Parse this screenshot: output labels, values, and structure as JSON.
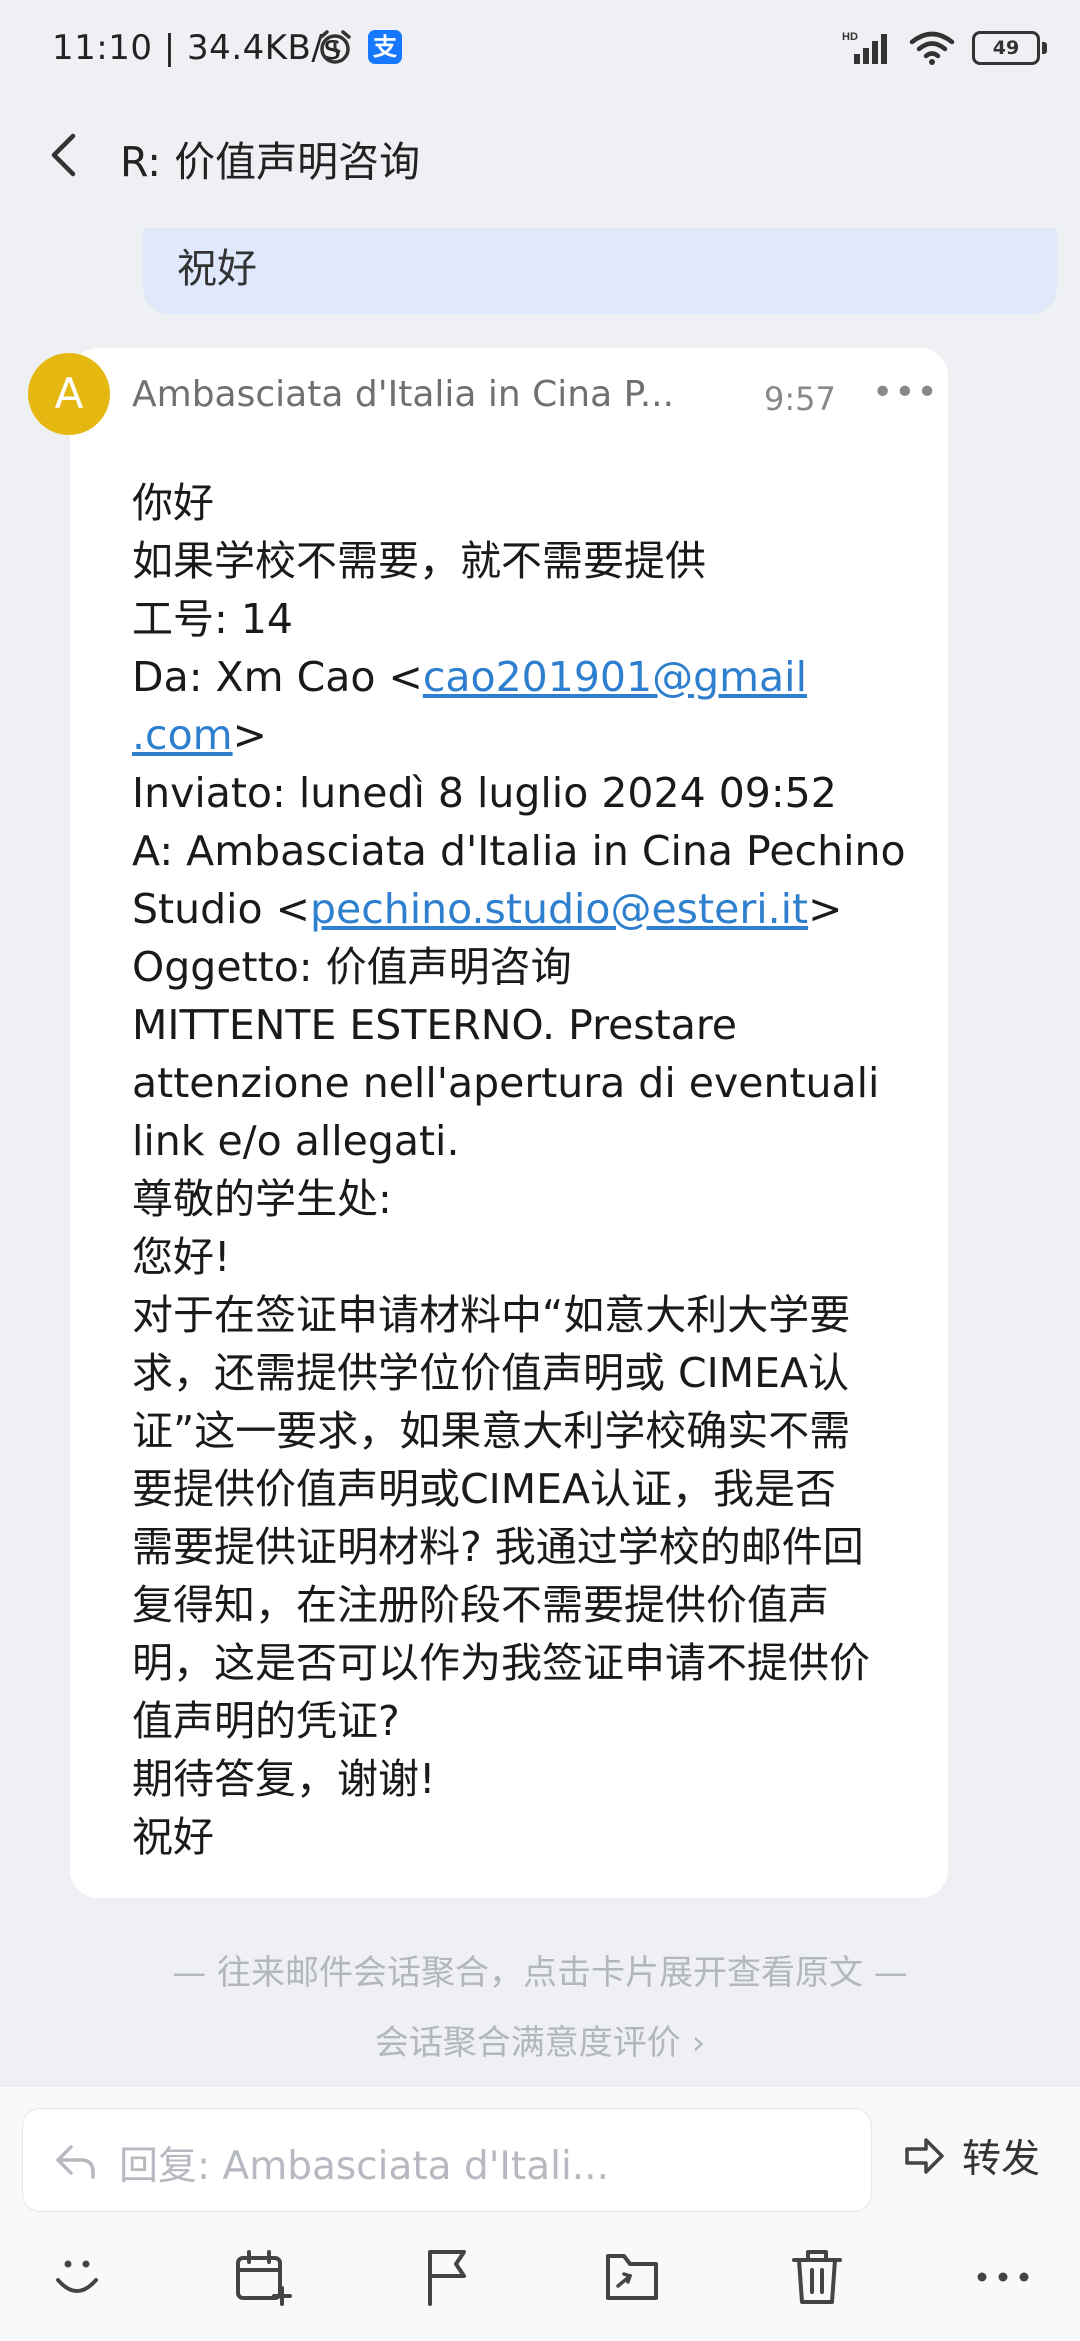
{
  "status": {
    "time": "11:10 | 34.4KB/s",
    "network": "HD",
    "battery": "49",
    "icons": [
      "alarm-icon",
      "alipay-icon",
      "signal-icon",
      "wifi-icon",
      "battery-icon"
    ]
  },
  "header": {
    "title": "R: 价值声明咨询"
  },
  "previous_message": {
    "text": "祝好"
  },
  "mail": {
    "avatar_letter": "A",
    "sender": "Ambasciata d'Italia in Cina P...",
    "time": "9:57",
    "lines": {
      "l1": "你好",
      "l2": "如果学校不需要，就不需要提供",
      "l3": "工号: 14",
      "da_prefix": "Da: Xm Cao <",
      "da_link_1": "cao201901@gmail",
      "da_link_2": ".com",
      "da_suffix": ">",
      "inviato": "Inviato: lunedì 8 luglio 2024 09:52",
      "a_line": "A: Ambasciata d'Italia in Cina Pechino",
      "studio_prefix": "Studio <",
      "studio_link": "pechino.studio@esteri.it",
      "studio_suffix": ">",
      "oggetto": "Oggetto: 价值声明咨询",
      "mittente_1": "MITTENTE ESTERNO. Prestare",
      "mittente_2": "attenzione nell'apertura di eventuali",
      "mittente_3": "link e/o allegati.",
      "greet1": "尊敬的学生处:",
      "greet2": "您好!",
      "p1": "对于在签证申请材料中“如意大利大学要",
      "p2": "求，还需提供学位价值声明或 CIMEA认",
      "p3": "证”这一要求，如果意大利学校确实不需",
      "p4": "要提供价值声明或CIMEA认证，我是否",
      "p5": "需要提供证明材料? 我通过学校的邮件回",
      "p6": "复得知，在注册阶段不需要提供价值声",
      "p7": "明，这是否可以作为我签证申请不提供价",
      "p8": "值声明的凭证?",
      "p9": "期待答复，谢谢!",
      "p10": "祝好"
    }
  },
  "footer": {
    "hint": "— 往来邮件会话聚合，点击卡片展开查看原文 —",
    "rating": "会话聚合满意度评价 ›"
  },
  "bottom": {
    "reply_placeholder": "回复: Ambasciata d'Itali...",
    "forward_label": "转发",
    "tools": [
      "smile-icon",
      "calendar-add-icon",
      "flag-icon",
      "move-folder-icon",
      "trash-icon",
      "more-icon"
    ]
  },
  "colors": {
    "accent_link": "#2f7fcf",
    "avatar": "#e5b811",
    "bubble": "#dfe9fb",
    "background": "#eef0f4"
  }
}
